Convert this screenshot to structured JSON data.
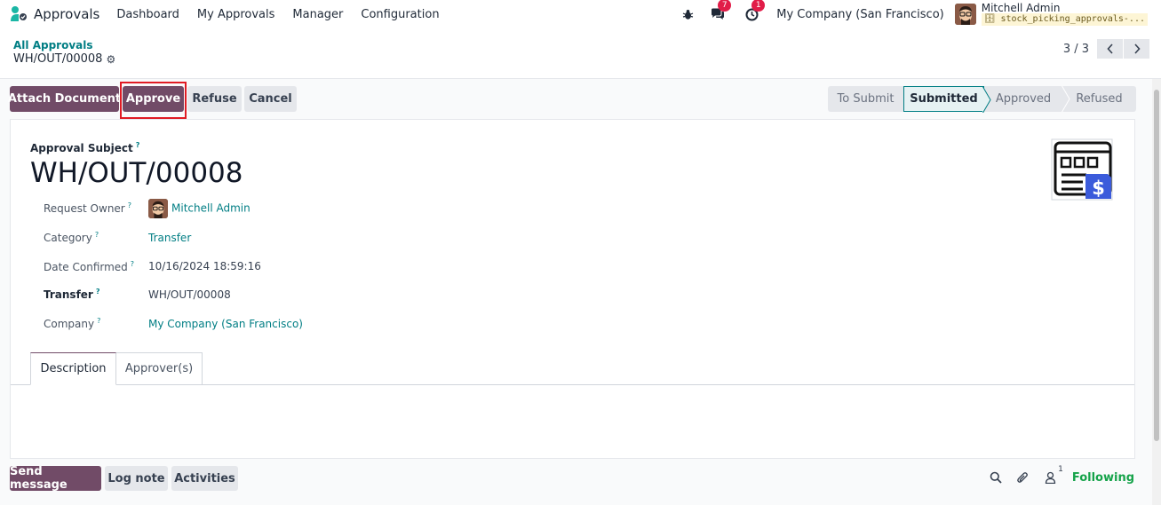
{
  "navbar": {
    "app_name": "Approvals",
    "menu": [
      "Dashboard",
      "My Approvals",
      "Manager",
      "Configuration"
    ],
    "icons": [
      "bug-icon",
      "chat-icon",
      "clock-icon"
    ],
    "messages_count": "7",
    "activities_count": "1",
    "company": "My Company (San Francisco)",
    "user_name": "Mitchell Admin",
    "database": "stock_picking_approvals-..."
  },
  "breadcrumb": {
    "parent": "All Approvals",
    "current": "WH/OUT/00008"
  },
  "pager": {
    "value": "3 / 3"
  },
  "actions": {
    "attach_document": "Attach Document",
    "approve": "Approve",
    "refuse": "Refuse",
    "cancel": "Cancel"
  },
  "stages": [
    {
      "label": "To Submit",
      "active": false
    },
    {
      "label": "Submitted",
      "active": true
    },
    {
      "label": "Approved",
      "active": false
    },
    {
      "label": "Refused",
      "active": false
    }
  ],
  "form": {
    "subject_label": "Approval Subject",
    "help_mark": "?",
    "title": "WH/OUT/00008",
    "fields": {
      "request_owner": {
        "label": "Request Owner",
        "value": "Mitchell Admin"
      },
      "category": {
        "label": "Category",
        "value": "Transfer"
      },
      "date_confirmed": {
        "label": "Date Confirmed",
        "value": "10/16/2024 18:59:16"
      },
      "transfer": {
        "label": "Transfer",
        "value": "WH/OUT/00008"
      },
      "company": {
        "label": "Company",
        "value": "My Company (San Francisco)"
      }
    },
    "tabs": [
      "Description",
      "Approver(s)"
    ]
  },
  "chatter": {
    "send_message": "Send message",
    "log_note": "Log note",
    "activities": "Activities",
    "followers_count": "1",
    "following": "Following"
  },
  "colors": {
    "primary": "#714b67",
    "accent": "#017e84",
    "highlight_frame": "#e01b24",
    "following": "#16a34a"
  }
}
